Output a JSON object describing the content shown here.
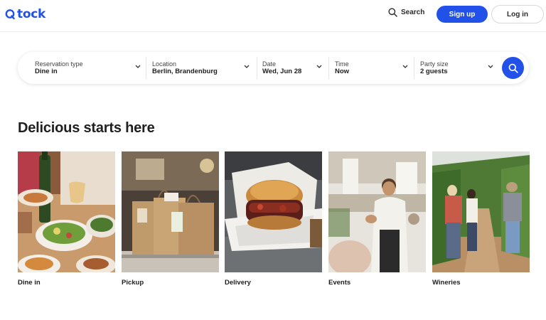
{
  "header": {
    "logo_text": "tock",
    "search_label": "Search",
    "signup_label": "Sign up",
    "login_label": "Log in"
  },
  "search_bar": {
    "fields": [
      {
        "label": "Reservation type",
        "value": "Dine in"
      },
      {
        "label": "Location",
        "value": "Berlin, Brandenburg"
      },
      {
        "label": "Date",
        "value": "Wed, Jun 28"
      },
      {
        "label": "Time",
        "value": "Now"
      },
      {
        "label": "Party size",
        "value": "2 guests"
      }
    ]
  },
  "section": {
    "title": "Delicious starts here",
    "categories": [
      {
        "label": "Dine in"
      },
      {
        "label": "Pickup"
      },
      {
        "label": "Delivery"
      },
      {
        "label": "Events"
      },
      {
        "label": "Wineries"
      }
    ]
  },
  "colors": {
    "brand": "#2151e8",
    "text": "#1f1f1f"
  }
}
